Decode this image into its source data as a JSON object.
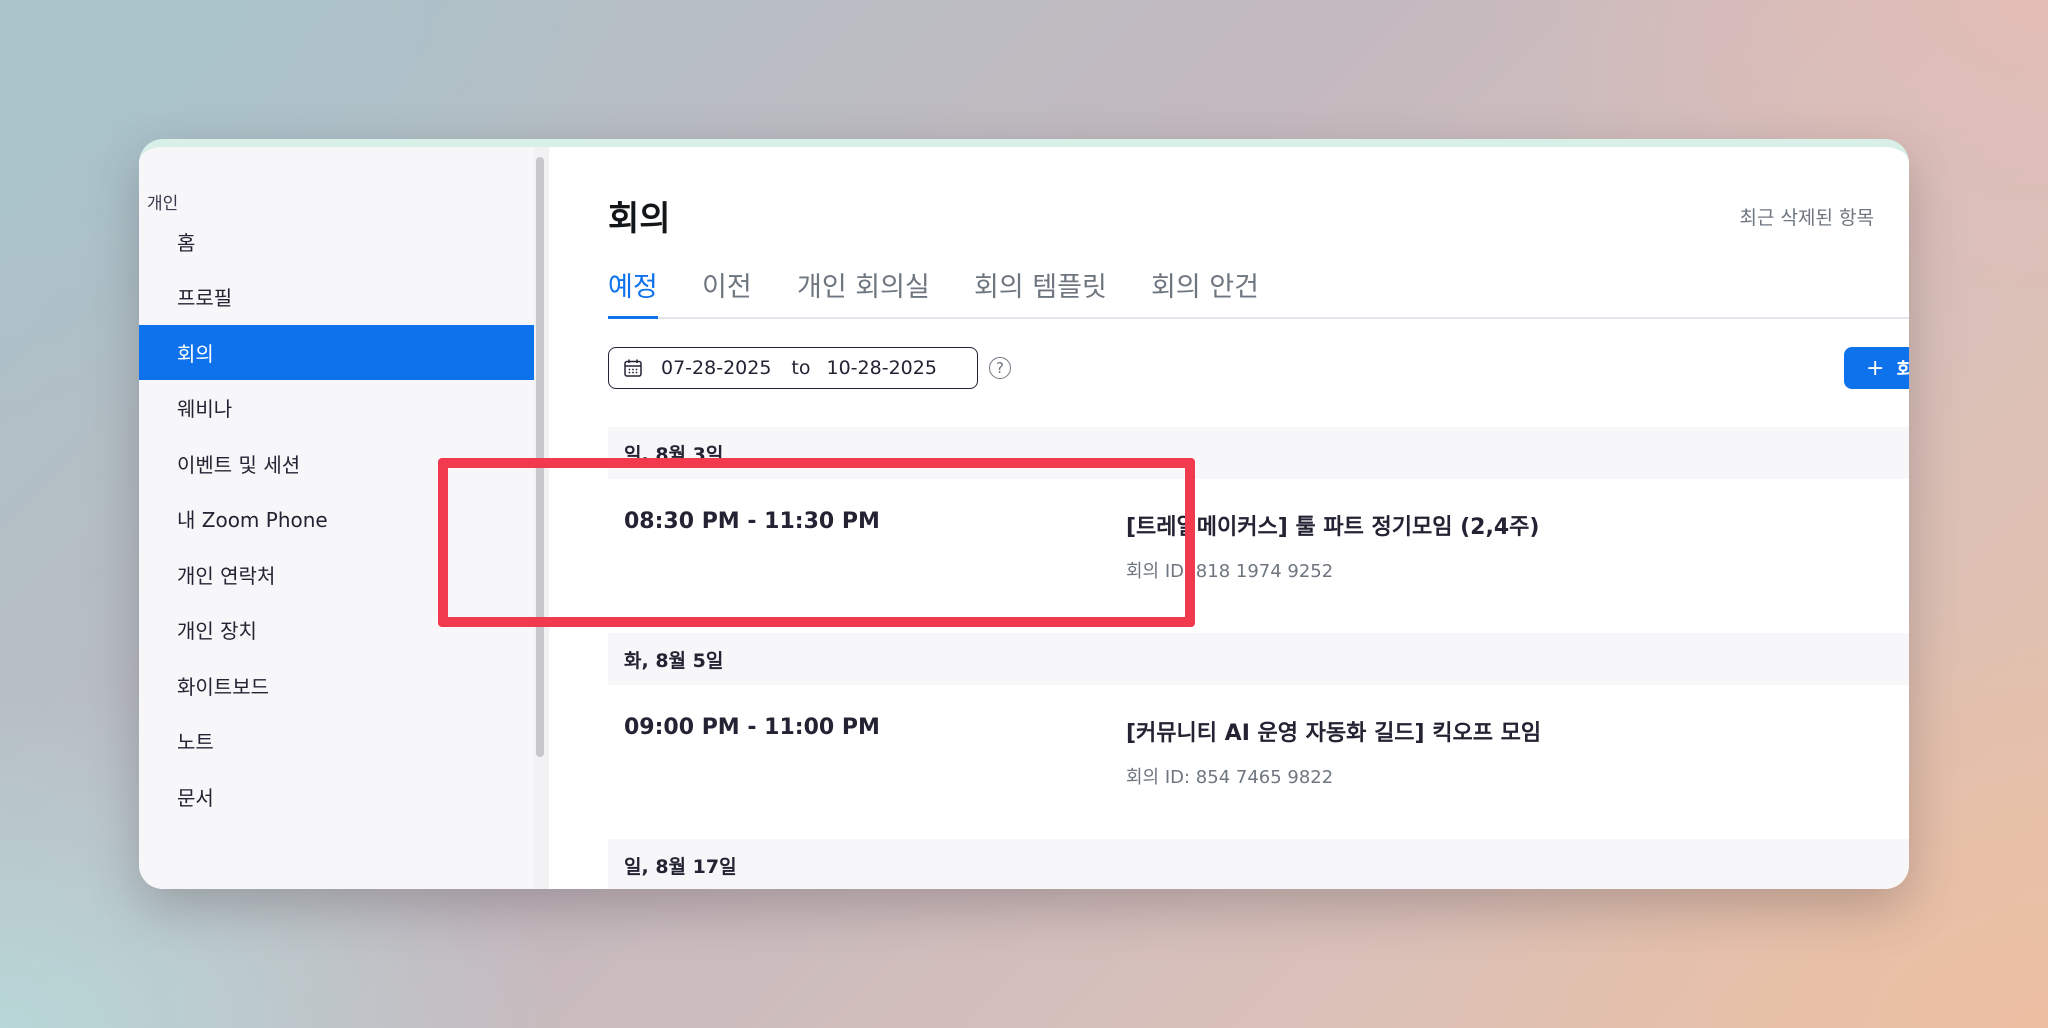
{
  "sidebar": {
    "heading": "개인",
    "items": [
      {
        "label": "홈"
      },
      {
        "label": "프로필"
      },
      {
        "label": "회의",
        "active": true
      },
      {
        "label": "웨비나"
      },
      {
        "label": "이벤트 및 세션"
      },
      {
        "label": "내 Zoom Phone"
      },
      {
        "label": "개인 연락처"
      },
      {
        "label": "개인 장치"
      },
      {
        "label": "화이트보드"
      },
      {
        "label": "노트"
      },
      {
        "label": "문서"
      }
    ]
  },
  "main": {
    "title": "회의",
    "recent_deleted": "최근 삭제된 항목",
    "tabs": [
      {
        "label": "예정",
        "active": true
      },
      {
        "label": "이전"
      },
      {
        "label": "개인 회의실"
      },
      {
        "label": "회의 템플릿"
      },
      {
        "label": "회의 안건"
      }
    ],
    "date_range": {
      "start": "07-28-2025",
      "to": "to",
      "end": "10-28-2025"
    },
    "help_glyph": "?",
    "schedule_button": {
      "icon": "+",
      "label": "회의"
    },
    "groups": [
      {
        "date": "일, 8월 3일",
        "meetings": [
          {
            "time": "08:30 PM - 11:30 PM",
            "title": "[트레일메이커스] 툴 파트 정기모임 (2,4주)",
            "id": "회의 ID: 818 1974 9252"
          }
        ]
      },
      {
        "date": "화, 8월 5일",
        "meetings": [
          {
            "time": "09:00 PM - 11:00 PM",
            "title": "[커뮤니티 AI 운영 자동화 길드] 킥오프 모임",
            "id": "회의 ID: 854 7465 9822"
          }
        ]
      },
      {
        "date": "일, 8월 17일",
        "meetings": []
      }
    ]
  },
  "colors": {
    "accent": "#0e72ed",
    "highlight": "#f23a4f",
    "text_primary": "#232333",
    "text_secondary": "#6e7680"
  },
  "icons": {
    "date_picker": "calendar-icon",
    "help": "question-circle-icon",
    "add": "plus-icon"
  }
}
